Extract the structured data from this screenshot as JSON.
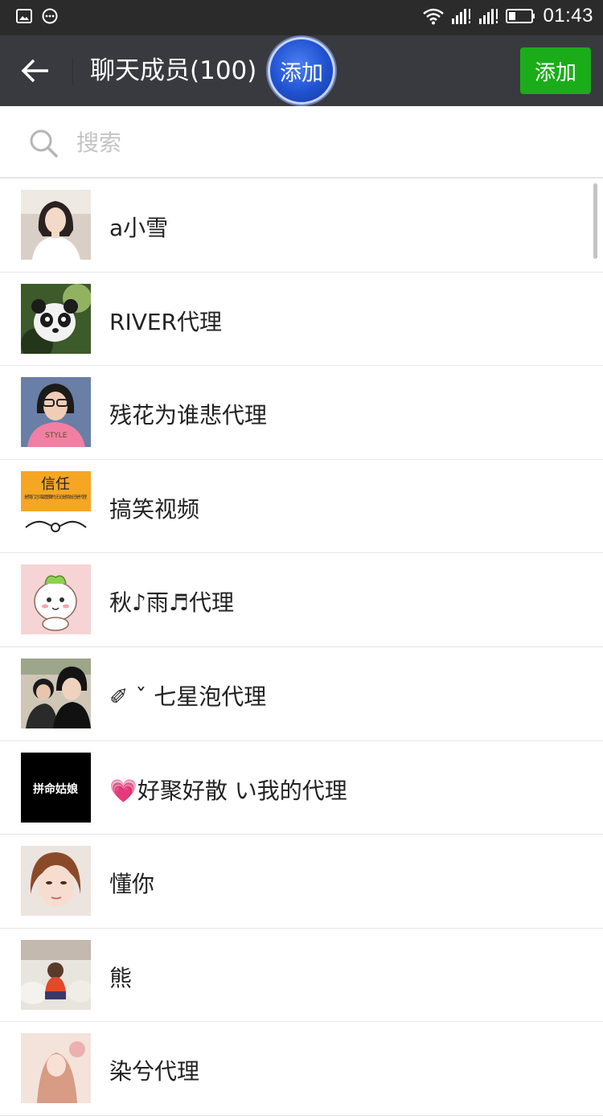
{
  "status_bar": {
    "time": "01:43",
    "icons": [
      "image-icon",
      "message-icon",
      "wifi-icon",
      "signal-icon",
      "signal-icon",
      "battery-icon"
    ]
  },
  "header": {
    "title": "聊天成员(100)",
    "bubble_label": "添加",
    "add_label": "添加"
  },
  "search": {
    "placeholder": "搜索"
  },
  "members": [
    {
      "name": "a小雪"
    },
    {
      "name": "RIVER代理"
    },
    {
      "name": "残花为谁悲代理"
    },
    {
      "name": "搞笑视频"
    },
    {
      "name": "秋♪雨♬代理"
    },
    {
      "name": "✐ ˇ 七星泡代理"
    },
    {
      "name": "💗好聚好散 い我的代理"
    },
    {
      "name": "懂你"
    },
    {
      "name": "熊"
    },
    {
      "name": "染兮代理"
    }
  ],
  "avatar_text": {
    "trust_title": "信任",
    "trust_sub": "是我们之间最重要的 无论是朋友还是代理",
    "black_text": "拼命姑娘"
  },
  "colors": {
    "header_bg": "#393a3f",
    "status_bg": "#2b2b2b",
    "accent_green": "#1aad19",
    "bubble_blue": "#1f52d1"
  }
}
